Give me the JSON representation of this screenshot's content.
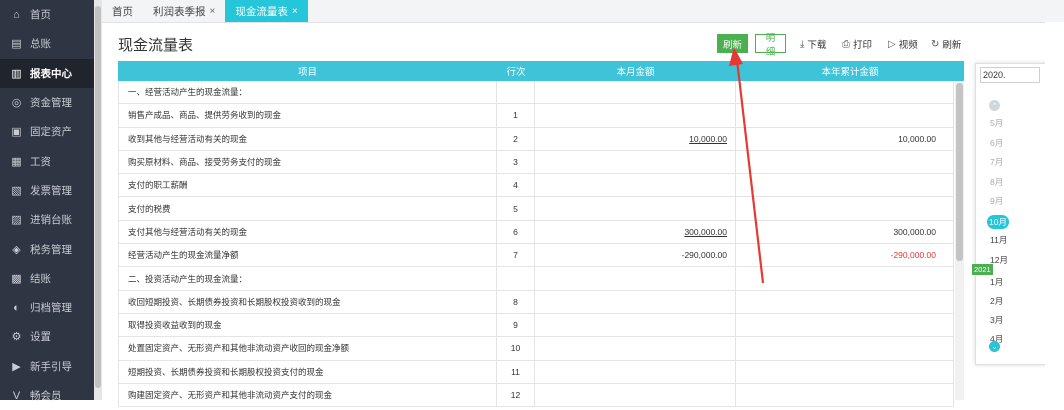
{
  "sidebar": {
    "items": [
      {
        "label": "首页",
        "icon": "home-icon",
        "glyph": "⌂"
      },
      {
        "label": "总账",
        "icon": "ledger-icon",
        "glyph": "▤"
      },
      {
        "label": "报表中心",
        "icon": "chart-icon",
        "glyph": "▥",
        "active": true
      },
      {
        "label": "资金管理",
        "icon": "money-icon",
        "glyph": "◎"
      },
      {
        "label": "固定资产",
        "icon": "asset-icon",
        "glyph": "▣"
      },
      {
        "label": "工资",
        "icon": "salary-icon",
        "glyph": "▦"
      },
      {
        "label": "发票管理",
        "icon": "invoice-icon",
        "glyph": "▧"
      },
      {
        "label": "进销台账",
        "icon": "stock-icon",
        "glyph": "▨"
      },
      {
        "label": "税务管理",
        "icon": "tax-icon",
        "glyph": "◈"
      },
      {
        "label": "结账",
        "icon": "close-book-icon",
        "glyph": "▩"
      },
      {
        "label": "归档管理",
        "icon": "archive-icon",
        "glyph": "◐"
      },
      {
        "label": "设置",
        "icon": "gear-icon",
        "glyph": "⚙"
      },
      {
        "label": "新手引导",
        "icon": "guide-icon",
        "glyph": "▶"
      },
      {
        "label": "畅会员",
        "icon": "vip-icon",
        "glyph": "V"
      }
    ]
  },
  "tabs": [
    {
      "label": "首页",
      "closable": false,
      "active": false
    },
    {
      "label": "利润表季报",
      "closable": true,
      "active": false
    },
    {
      "label": "现金流量表",
      "closable": true,
      "active": true
    }
  ],
  "tab_close_glyph": "×",
  "header": {
    "title": "现金流量表",
    "primary_button": "刷新",
    "secondary_button": "明细",
    "tools": [
      {
        "label": "下载",
        "icon": "download-icon",
        "glyph": "⤓"
      },
      {
        "label": "打印",
        "icon": "print-icon",
        "glyph": "⎙"
      },
      {
        "label": "视频",
        "icon": "video-icon",
        "glyph": "▷"
      },
      {
        "label": "刷新",
        "icon": "refresh-icon",
        "glyph": "↻"
      }
    ]
  },
  "table": {
    "columns": [
      "项目",
      "行次",
      "本月金额",
      "本年累计金额"
    ],
    "rows": [
      {
        "item": "一、经营活动产生的现金流量：",
        "line": "",
        "month": "",
        "year": ""
      },
      {
        "item": "销售产成品、商品、提供劳务收到的现金",
        "line": "1",
        "month": "",
        "year": ""
      },
      {
        "item": "收到其他与经营活动有关的现金",
        "line": "2",
        "month": "10,000.00",
        "year": "10,000.00",
        "month_ul": true
      },
      {
        "item": "购买原材料、商品、接受劳务支付的现金",
        "line": "3",
        "month": "",
        "year": ""
      },
      {
        "item": "支付的职工薪酬",
        "line": "4",
        "month": "",
        "year": ""
      },
      {
        "item": "支付的税费",
        "line": "5",
        "month": "",
        "year": ""
      },
      {
        "item": "支付其他与经营活动有关的现金",
        "line": "6",
        "month": "300,000.00",
        "year": "300,000.00",
        "month_ul": true
      },
      {
        "item": "经营活动产生的现金流量净额",
        "line": "7",
        "month": "-290,000.00",
        "year": "-290,000.00",
        "year_neg": true
      },
      {
        "item": "二、投资活动产生的现金流量：",
        "line": "",
        "month": "",
        "year": ""
      },
      {
        "item": "收回短期投资、长期债券投资和长期股权投资收到的现金",
        "line": "8",
        "month": "",
        "year": ""
      },
      {
        "item": "取得投资收益收到的现金",
        "line": "9",
        "month": "",
        "year": ""
      },
      {
        "item": "处置固定资产、无形资产和其他非流动资产收回的现金净额",
        "line": "10",
        "month": "",
        "year": ""
      },
      {
        "item": "短期投资、长期债券投资和长期股权投资支付的现金",
        "line": "11",
        "month": "",
        "year": ""
      },
      {
        "item": "购建固定资产、无形资产和其他非流动资产支付的现金",
        "line": "12",
        "month": "",
        "year": ""
      }
    ]
  },
  "date_picker": {
    "value": "2020.",
    "months_top": [
      "5月",
      "6月",
      "7月",
      "8月",
      "9月",
      "10月",
      "11月",
      "12月"
    ],
    "year_badge": "2021",
    "months_bottom": [
      "1月",
      "2月",
      "3月",
      "4月"
    ]
  },
  "colors": {
    "accent": "#26c6da",
    "header": "#3ec3d9",
    "green": "#4caf50",
    "negative": "#e53935",
    "annotation": "#e53935"
  }
}
